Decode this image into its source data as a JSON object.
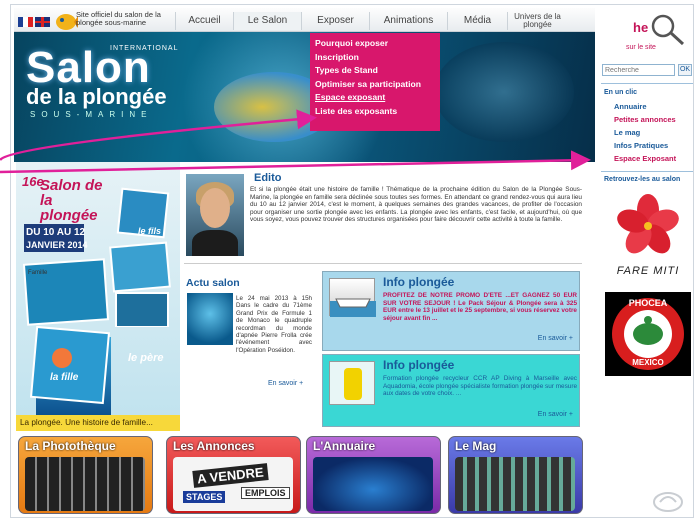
{
  "header": {
    "site_official": "Site officiel du salon de la plongée sous-marine",
    "nav": [
      "Accueil",
      "Le Salon",
      "Exposer",
      "Animations",
      "Média",
      "Univers de la plongée"
    ]
  },
  "hero": {
    "international": "INTERNATIONAL",
    "salon": "Salon",
    "de_la_plongee": "de la plongée",
    "sous_marine": "SOUS-MARINE"
  },
  "dropdown": {
    "items": [
      "Pourquoi exposer",
      "Inscription",
      "Types de Stand",
      "Optimiser sa participation",
      "Espace exposant",
      "Liste des exposants"
    ]
  },
  "sidebar": {
    "sur_site": "sur le site",
    "search_placeholder": "Recherche",
    "ok": "OK",
    "en_un_clic": "En un clic",
    "links": [
      "Annuaire",
      "Petites annonces",
      "Le mag",
      "Infos Pratiques",
      "Espace Exposant"
    ],
    "retrouvez": "Retrouvez-les au salon",
    "fare_miti": "FARE MITI",
    "phocea": "PHOCEA",
    "mexico": "MEXICO"
  },
  "poster": {
    "edition": "16e",
    "title": "Salon de la plongée",
    "dates": "DU 10 AU 12",
    "month": "JANVIER 2014",
    "labels": [
      "le fils",
      "le père",
      "la fille",
      "Famille"
    ],
    "caption": "La plongée. Une histoire de famille..."
  },
  "edito": {
    "title": "Edito",
    "text": "Et si la plongée était une histoire de famille ! Thématique de la prochaine édition du Salon de la Plongée Sous-Marine, la plongée en famille sera déclinée sous toutes ses formes. En attendant ce grand rendez-vous qui aura lieu du 10 au 12 janvier 2014, c'est le moment, à quelques semaines des grandes vacances, de profiter de l'occasion pour organiser une sortie plongée avec les enfants. La plongée avec les enfants, c'est facile, et aujourd'hui, où que vous soyez, vous pouvez trouver des structures organisées pour faire découvrir cette activité à toute la famille."
  },
  "actu": {
    "title": "Actu salon",
    "text": "Le 24 mai 2013 à 15h Dans le cadre du 71ème Grand Prix de Formule 1 de Monaco le quadruple recordman du monde d'apnée Pierre Frolla crée l'événement avec l'Opération Poséidon.",
    "more": "En savoir +"
  },
  "info1": {
    "title": "Info plongée",
    "text": "PROFITEZ DE NOTRE PROMO D'ETE ...ET GAGNEZ 50 EUR SUR VOTRE SEJOUR ! Le Pack Séjour & Plongée sera à 325 EUR entre le 13 juillet et le 25 septembre, si vous réservez votre séjour avant fin ...",
    "more": "En savoir +"
  },
  "info2": {
    "title": "Info plongée",
    "text": "Formation plongée recycleur CCR AP Diving à Marseille avec Aquadomia, école plongée spécialiste formation plongée sur mesure aux dates de votre choix. ...",
    "more": "En savoir +"
  },
  "tiles": {
    "phototheque": "La Photothèque",
    "annonces": "Les Annonces",
    "annuaire": "L'Annuaire",
    "mag": "Le Mag",
    "a_vendre": "A VENDRE",
    "stages": "STAGES",
    "emplois": "EMPLOIS"
  },
  "colors": {
    "brand_blue": "#1a5a99",
    "magenta": "#d8176c",
    "arrow": "#e0209a"
  }
}
